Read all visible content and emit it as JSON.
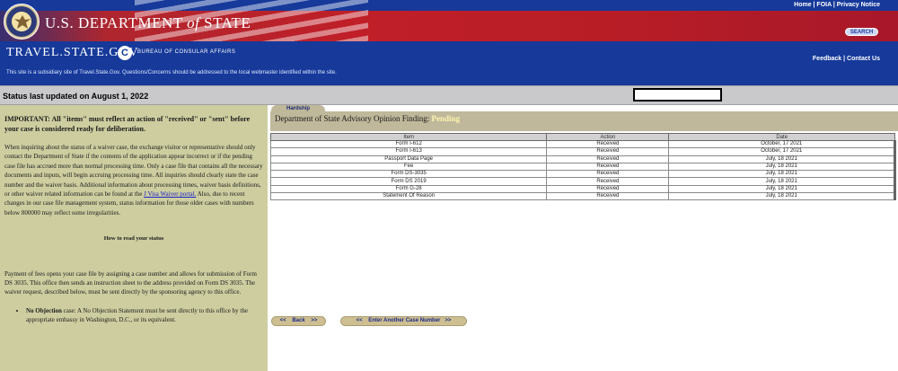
{
  "header": {
    "top_links": "Home | FOIA | Privacy Notice",
    "title_main": "U.S. DEPARTMENT ",
    "title_of": "of",
    "title_state": " STATE",
    "logo_text": "TRAVEL.STATE.GOV",
    "logo_glyph": "C",
    "bureau": "BUREAU OF CONSULAR AFFAIRS",
    "subsidiary_notice": "This site is a subsidiary site of Travel.State.Gov. Questions/Concerns should be addressed to the local webmaster identified within the site.",
    "search_label": "SEARCH",
    "feedback_links": "Feedback | Contact Us",
    "colors": {
      "header_blue": "#16399a",
      "header_red": "#c01f28"
    }
  },
  "status_bar": {
    "text": "Status last updated on August 1, 2022",
    "case_number_value": ""
  },
  "left_panel": {
    "important": "IMPORTANT: All \"items\" must reflect an action of \"received\" or \"sent\" before your case is considered ready for deliberation.",
    "para1_before_link": "When inquiring about the status of a waiver case, the exchange visitor or representative should only contact the Department of State if the contents of the application appear incorrect or if the pending case file has accrued more than normal processing time.  Only a case file that contains all the necessary documents and inputs, will begin accruing processing time. All inquiries should clearly state the case number and the waiver basis.  Additional information about processing times, waiver basis definitions, or other waiver related information can be found at the ",
    "para1_link": "J Visa Waiver portal.",
    "para1_after_link": "  Also, due to recent changes in our case file management system, status information for those older cases with numbers below 800000 may reflect some irregularities.",
    "how_to_title": "How to read your status",
    "para2": "Payment of fees opens your case file by assigning a case number and allows for submission of Form DS 3035.  This office then sends an instruction sheet to the address provided on Form DS 3035.  The waiver request, described below, must be sent directly by the sponsoring agency to this office.",
    "bullet1_title": "No Objection",
    "bullet1_text": " case: A No Objection Statement must be sent directly to this office by the appropriate embassy in Washington, D.C., or its equivalent."
  },
  "main": {
    "tab_label": "Hardship",
    "finding_label": "Department of State Advisory Opinion Finding: ",
    "finding_status": "Pending",
    "table": {
      "headers": [
        "Item",
        "Action",
        "Date"
      ],
      "rows": [
        [
          "Form I-612",
          "Received",
          "October, 17 2021"
        ],
        [
          "Form I-613",
          "Received",
          "October, 17 2021"
        ],
        [
          "Passport Data Page",
          "Received",
          "July, 18 2021"
        ],
        [
          "Fee",
          "Received",
          "July, 18 2021"
        ],
        [
          "Form DS-3035",
          "Received",
          "July, 18 2021"
        ],
        [
          "Form DS 2019",
          "Received",
          "July, 18 2021"
        ],
        [
          "Form G-28",
          "Received",
          "July, 18 2021"
        ],
        [
          "Statement Of Reason",
          "Received",
          "July, 18 2021"
        ]
      ]
    },
    "back_label": "Back",
    "another_label": "Enter Another Case Number",
    "arrow_left": "<<",
    "arrow_right": ">>"
  }
}
